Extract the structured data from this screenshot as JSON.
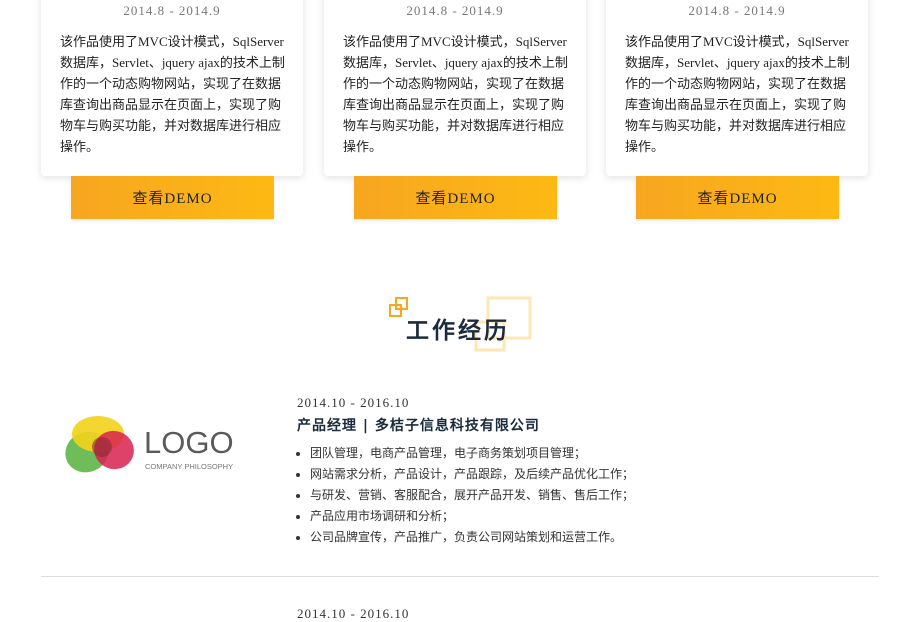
{
  "projects": [
    {
      "date": "2014.8 - 2014.9",
      "desc": "该作品使用了MVC设计模式，SqlServer数据库，Servlet、jquery ajax的技术上制作的一个动态购物网站，实现了在数据库查询出商品显示在页面上，实现了购物车与购买功能，并对数据库进行相应操作。",
      "button": "查看DEMO"
    },
    {
      "date": "2014.8 - 2014.9",
      "desc": "该作品使用了MVC设计模式，SqlServer数据库，Servlet、jquery ajax的技术上制作的一个动态购物网站，实现了在数据库查询出商品显示在页面上，实现了购物车与购买功能，并对数据库进行相应操作。",
      "button": "查看DEMO"
    },
    {
      "date": "2014.8 - 2014.9",
      "desc": "该作品使用了MVC设计模式，SqlServer数据库，Servlet、jquery ajax的技术上制作的一个动态购物网站，实现了在数据库查询出商品显示在页面上，实现了购物车与购买功能，并对数据库进行相应操作。",
      "button": "查看DEMO"
    }
  ],
  "section": {
    "title": "工作经历"
  },
  "jobs": [
    {
      "logo_text": "LOGO",
      "logo_sub": "COMPANY PHILOSOPHY",
      "date": "2014.10 - 2016.10",
      "title": "产品经理 | 多桔子信息科技有限公司",
      "duties": [
        "团队管理，电商产品管理，电子商务策划项目管理；",
        "网站需求分析，产品设计，产品跟踪，及后续产品优化工作；",
        "与研发、营销、客服配合，展开产品开发、销售、售后工作；",
        "产品应用市场调研和分析；",
        "公司品牌宣传，产品推广，负责公司网站策划和运营工作。"
      ]
    },
    {
      "date": "2014.10 - 2016.10"
    }
  ],
  "colors": {
    "accent": "#fdb913",
    "accent_dark": "#f7a620",
    "title": "#1b2a3c"
  }
}
